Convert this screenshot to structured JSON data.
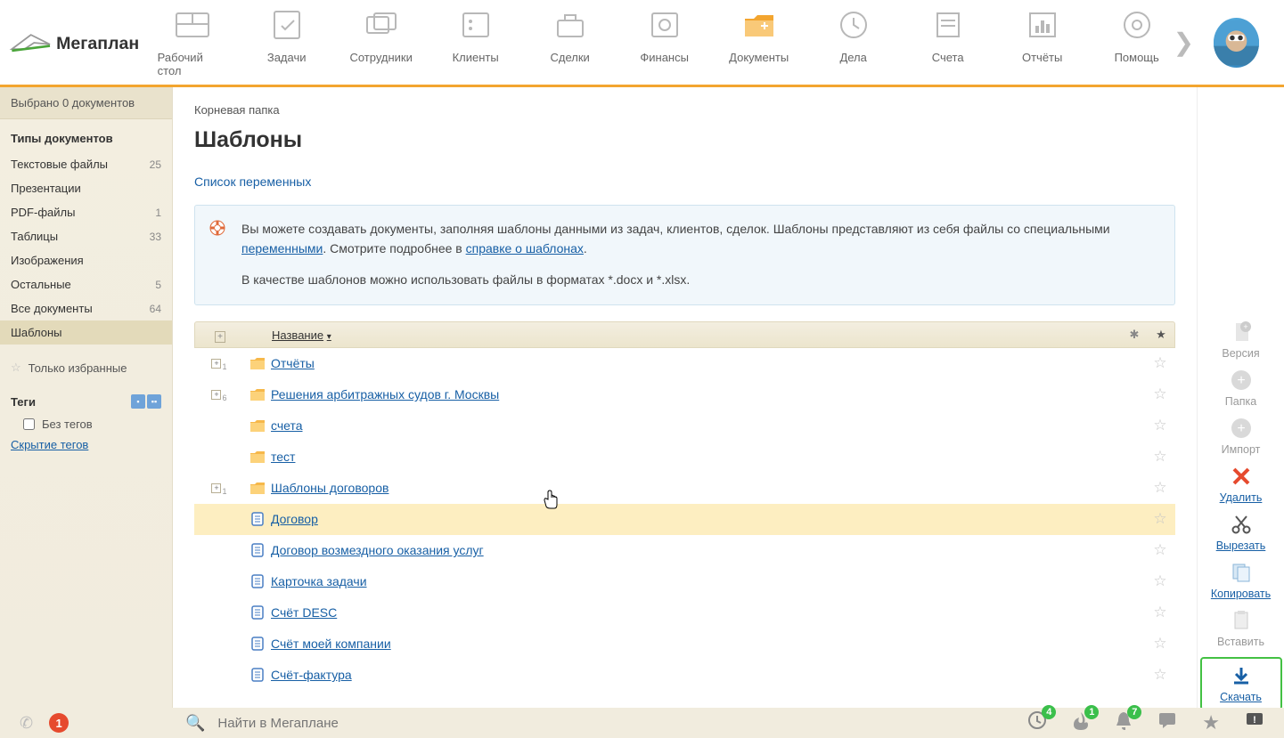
{
  "nav": {
    "items": [
      {
        "label": "Рабочий стол"
      },
      {
        "label": "Задачи"
      },
      {
        "label": "Сотрудники"
      },
      {
        "label": "Клиенты"
      },
      {
        "label": "Сделки"
      },
      {
        "label": "Финансы"
      },
      {
        "label": "Документы"
      },
      {
        "label": "Дела"
      },
      {
        "label": "Счета"
      },
      {
        "label": "Отчёты"
      },
      {
        "label": "Помощь"
      }
    ]
  },
  "sidebar": {
    "selected_bar": "Выбрано 0 документов",
    "types_header": "Типы документов",
    "items": [
      {
        "label": "Текстовые файлы",
        "count": "25"
      },
      {
        "label": "Презентации",
        "count": ""
      },
      {
        "label": "PDF-файлы",
        "count": "1"
      },
      {
        "label": "Таблицы",
        "count": "33"
      },
      {
        "label": "Изображения",
        "count": ""
      },
      {
        "label": "Остальные",
        "count": "5"
      },
      {
        "label": "Все документы",
        "count": "64"
      }
    ],
    "templates_label": "Шаблоны",
    "fav_label": "Только избранные",
    "tags_header": "Теги",
    "no_tags_label": "Без тегов",
    "hide_tags_label": "Скрытие тегов"
  },
  "main": {
    "breadcrumb": "Корневая папка",
    "title": "Шаблоны",
    "vars_link": "Список переменных",
    "info_text_1": "Вы можете создавать документы, заполняя шаблоны данными из задач, клиентов, сделок. Шаблоны представляют из себя файлы со специальными ",
    "info_link_1": "переменными",
    "info_text_2": ". Смотрите подробнее в ",
    "info_link_2": "справке о шаблонах",
    "info_text_3": "В качестве шаблонов можно использовать файлы в форматах *.docx и *.xlsx.",
    "col_name": "Название",
    "rows": [
      {
        "type": "folder",
        "plus": "1",
        "label": "Отчёты"
      },
      {
        "type": "folder",
        "plus": "6",
        "label": "Решения арбитражных судов г. Москвы"
      },
      {
        "type": "folder",
        "plus": "",
        "label": "счета"
      },
      {
        "type": "folder",
        "plus": "",
        "label": "тест"
      },
      {
        "type": "folder",
        "plus": "1",
        "label": "Шаблоны договоров"
      },
      {
        "type": "doc",
        "plus": "",
        "label": "Договор",
        "selected": true
      },
      {
        "type": "doc",
        "plus": "",
        "label": "Договор возмездного оказания услуг"
      },
      {
        "type": "doc",
        "plus": "",
        "label": "Карточка задачи"
      },
      {
        "type": "doc",
        "plus": "",
        "label": "Счёт DESC"
      },
      {
        "type": "doc",
        "plus": "",
        "label": "Счёт моей компании"
      },
      {
        "type": "doc",
        "plus": "",
        "label": "Счёт-фактура"
      }
    ]
  },
  "rail": {
    "items": [
      {
        "label": "Версия"
      },
      {
        "label": "Папка"
      },
      {
        "label": "Импорт"
      },
      {
        "label": "Удалить"
      },
      {
        "label": "Вырезать"
      },
      {
        "label": "Копировать"
      },
      {
        "label": "Вставить"
      },
      {
        "label": "Скачать"
      }
    ]
  },
  "bottom": {
    "badge": "1",
    "search_placeholder": "Найти в Мегаплане",
    "notif": {
      "n1": "4",
      "n2": "1",
      "n3": "7"
    }
  }
}
